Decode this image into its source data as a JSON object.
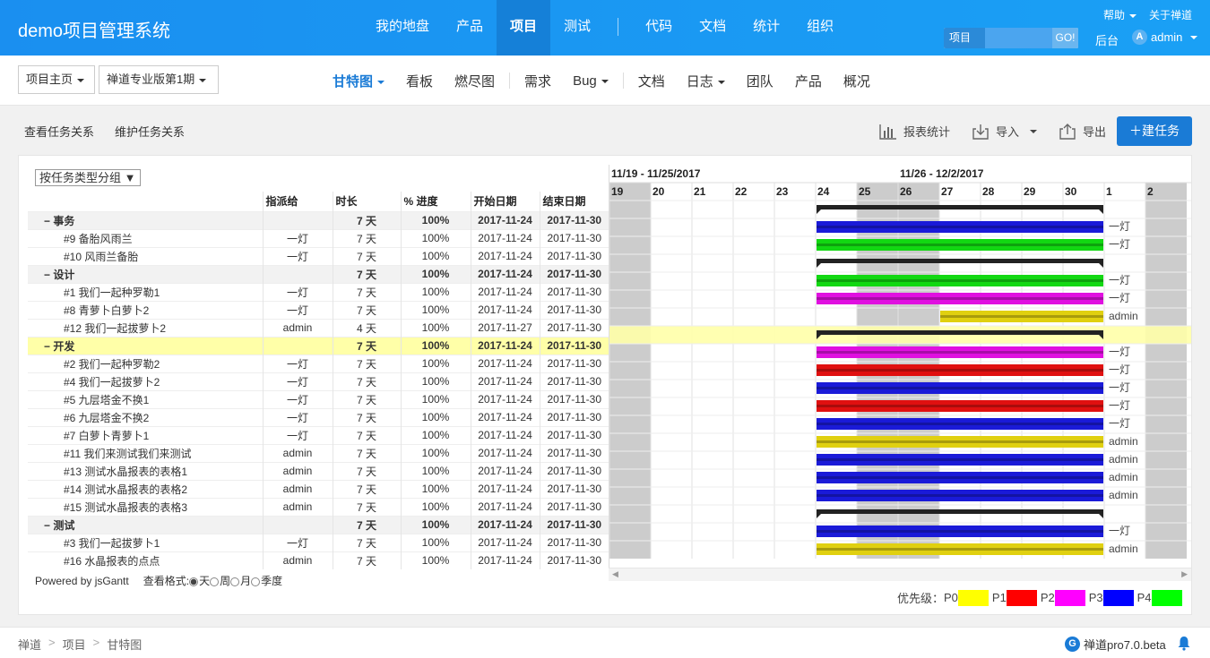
{
  "header": {
    "brand": "demo项目管理系统",
    "nav": [
      "我的地盘",
      "产品",
      "项目",
      "测试",
      "代码",
      "文档",
      "统计",
      "组织"
    ],
    "active_nav": "项目",
    "help": "帮助",
    "about": "关于禅道",
    "search_scope": "项目",
    "search_value": "",
    "search_go": "GO!",
    "backend": "后台",
    "avatar_letter": "A",
    "user": "admin"
  },
  "subnav": {
    "crumb_home": "项目主页",
    "crumb_project": "禅道专业版第1期",
    "items": [
      "甘特图",
      "看板",
      "燃尽图",
      "需求",
      "Bug",
      "文档",
      "日志",
      "团队",
      "产品",
      "概况"
    ],
    "active": "甘特图"
  },
  "actions": {
    "view_relations": "查看任务关系",
    "maintain_relations": "维护任务关系",
    "report": "报表统计",
    "import": "导入",
    "export": "导出",
    "create": "建任务"
  },
  "gantt": {
    "group_select": "按任务类型分组",
    "columns": [
      "",
      "指派给",
      "时长",
      "% 进度",
      "开始日期",
      "结束日期"
    ],
    "rows": [
      {
        "type": "group",
        "name": "−  事务",
        "assignee": "",
        "duration": "7 天",
        "progress": "100%",
        "start": "2017-11-24",
        "end": "2017-11-30"
      },
      {
        "type": "task",
        "name": "#9 备胎风雨兰",
        "assignee": "一灯",
        "duration": "7 天",
        "progress": "100%",
        "start": "2017-11-24",
        "end": "2017-11-30",
        "color": "#1a1ad8",
        "label": "一灯"
      },
      {
        "type": "task",
        "name": "#10 风雨兰备胎",
        "assignee": "一灯",
        "duration": "7 天",
        "progress": "100%",
        "start": "2017-11-24",
        "end": "2017-11-30",
        "color": "#12d812",
        "label": "一灯"
      },
      {
        "type": "group",
        "name": "−  设计",
        "assignee": "",
        "duration": "7 天",
        "progress": "100%",
        "start": "2017-11-24",
        "end": "2017-11-30"
      },
      {
        "type": "task",
        "name": "#1 我们一起种罗勒1",
        "assignee": "一灯",
        "duration": "7 天",
        "progress": "100%",
        "start": "2017-11-24",
        "end": "2017-11-30",
        "color": "#12d812",
        "label": "一灯"
      },
      {
        "type": "task",
        "name": "#8 青萝卜白萝卜2",
        "assignee": "一灯",
        "duration": "7 天",
        "progress": "100%",
        "start": "2017-11-24",
        "end": "2017-11-30",
        "color": "#e010e0",
        "label": "一灯"
      },
      {
        "type": "task",
        "name": "#12 我们一起拔萝卜2",
        "assignee": "admin",
        "duration": "4 天",
        "progress": "100%",
        "start": "2017-11-27",
        "end": "2017-11-30",
        "color": "#e0d010",
        "label": "admin"
      },
      {
        "type": "group",
        "name": "−  开发",
        "assignee": "",
        "duration": "7 天",
        "progress": "100%",
        "start": "2017-11-24",
        "end": "2017-11-30",
        "highlight": true
      },
      {
        "type": "task",
        "name": "#2 我们一起种罗勒2",
        "assignee": "一灯",
        "duration": "7 天",
        "progress": "100%",
        "start": "2017-11-24",
        "end": "2017-11-30",
        "color": "#e010e0",
        "label": "一灯"
      },
      {
        "type": "task",
        "name": "#4 我们一起拔萝卜2",
        "assignee": "一灯",
        "duration": "7 天",
        "progress": "100%",
        "start": "2017-11-24",
        "end": "2017-11-30",
        "color": "#e01010",
        "label": "一灯"
      },
      {
        "type": "task",
        "name": "#5 九层塔金不换1",
        "assignee": "一灯",
        "duration": "7 天",
        "progress": "100%",
        "start": "2017-11-24",
        "end": "2017-11-30",
        "color": "#1a1ad8",
        "label": "一灯"
      },
      {
        "type": "task",
        "name": "#6 九层塔金不换2",
        "assignee": "一灯",
        "duration": "7 天",
        "progress": "100%",
        "start": "2017-11-24",
        "end": "2017-11-30",
        "color": "#e01010",
        "label": "一灯"
      },
      {
        "type": "task",
        "name": "#7 白萝卜青萝卜1",
        "assignee": "一灯",
        "duration": "7 天",
        "progress": "100%",
        "start": "2017-11-24",
        "end": "2017-11-30",
        "color": "#1a1ad8",
        "label": "一灯"
      },
      {
        "type": "task",
        "name": "#11 我们来测试我们来测试",
        "assignee": "admin",
        "duration": "7 天",
        "progress": "100%",
        "start": "2017-11-24",
        "end": "2017-11-30",
        "color": "#e0d010",
        "label": "admin"
      },
      {
        "type": "task",
        "name": "#13 测试水晶报表的表格1",
        "assignee": "admin",
        "duration": "7 天",
        "progress": "100%",
        "start": "2017-11-24",
        "end": "2017-11-30",
        "color": "#1a1ad8",
        "label": "admin"
      },
      {
        "type": "task",
        "name": "#14 测试水晶报表的表格2",
        "assignee": "admin",
        "duration": "7 天",
        "progress": "100%",
        "start": "2017-11-24",
        "end": "2017-11-30",
        "color": "#1a1ad8",
        "label": "admin"
      },
      {
        "type": "task",
        "name": "#15 测试水晶报表的表格3",
        "assignee": "admin",
        "duration": "7 天",
        "progress": "100%",
        "start": "2017-11-24",
        "end": "2017-11-30",
        "color": "#1a1ad8",
        "label": "admin"
      },
      {
        "type": "group",
        "name": "−  测试",
        "assignee": "",
        "duration": "7 天",
        "progress": "100%",
        "start": "2017-11-24",
        "end": "2017-11-30"
      },
      {
        "type": "task",
        "name": "#3 我们一起拔萝卜1",
        "assignee": "一灯",
        "duration": "7 天",
        "progress": "100%",
        "start": "2017-11-24",
        "end": "2017-11-30",
        "color": "#1a1ad8",
        "label": "一灯"
      },
      {
        "type": "task",
        "name": "#16 水晶报表的点点",
        "assignee": "admin",
        "duration": "7 天",
        "progress": "100%",
        "start": "2017-11-24",
        "end": "2017-11-30",
        "color": "#e0d010",
        "label": "admin"
      }
    ],
    "weeks": [
      "11/19 - 11/25/2017",
      "11/26 - 12/2/2017"
    ],
    "days": [
      "19",
      "20",
      "21",
      "22",
      "23",
      "24",
      "25",
      "26",
      "27",
      "28",
      "29",
      "30",
      "1",
      "2"
    ],
    "weekend_days": [
      "19",
      "25",
      "26",
      "2"
    ],
    "powered_by": "Powered by jsGantt",
    "view_format_label": "查看格式:",
    "view_formats": [
      "天",
      "周",
      "月",
      "季度"
    ],
    "view_format_selected": "天",
    "priority_label": "优先级：",
    "priorities": [
      {
        "name": "P0",
        "color": "#ffff00"
      },
      {
        "name": "P1",
        "color": "#ff0000"
      },
      {
        "name": "P2",
        "color": "#ff00ff"
      },
      {
        "name": "P3",
        "color": "#0000ff"
      },
      {
        "name": "P4",
        "color": "#00ff00"
      }
    ]
  },
  "footer": {
    "breadcrumb": [
      "禅道",
      "项目",
      "甘特图"
    ],
    "version": "禅道pro7.0.beta",
    "logo_letter": "G"
  }
}
